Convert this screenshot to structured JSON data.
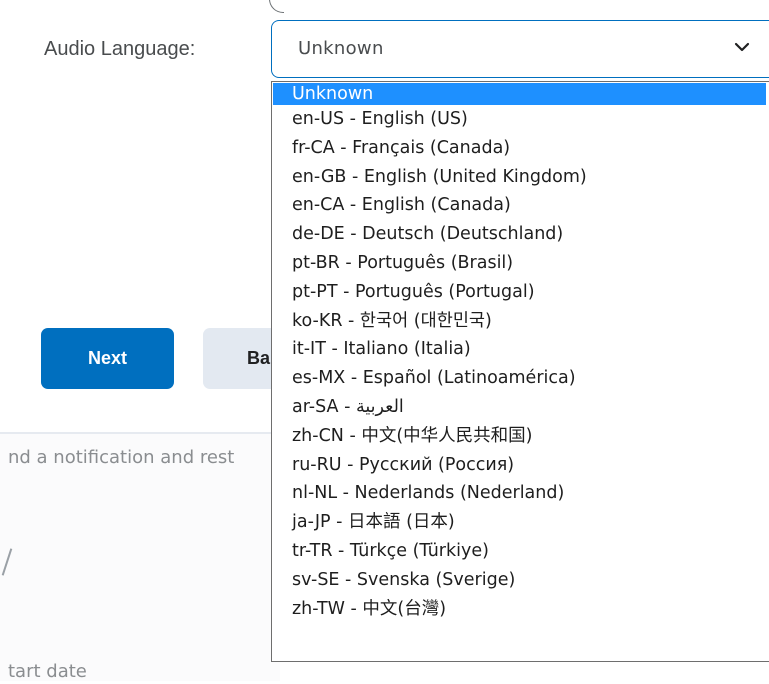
{
  "form": {
    "audio_language_label": "Audio Language:",
    "select_value": "Unknown",
    "chevron_icon": "chevron-down-icon"
  },
  "dropdown": {
    "options": [
      "Unknown",
      "en-US - English (US)",
      "fr-CA - Français (Canada)",
      "en-GB - English (United Kingdom)",
      "en-CA - English (Canada)",
      "de-DE - Deutsch (Deutschland)",
      "pt-BR - Português (Brasil)",
      "pt-PT - Português (Portugal)",
      "ko-KR - 한국어 (대한민국)",
      "it-IT - Italiano (Italia)",
      "es-MX - Español (Latinoamérica)",
      "ar-SA - العربية",
      "zh-CN - 中文(中华人民共和国)",
      "ru-RU - Русский (Россия)",
      "nl-NL - Nederlands (Nederland)",
      "ja-JP - 日本語 (日本)",
      "tr-TR - Türkçe (Türkiye)",
      "sv-SE - Svenska (Sverige)",
      "zh-TW - 中文(台灣)"
    ],
    "selected_index": 0,
    "highlight_color": "#1e90ff"
  },
  "actions": {
    "next_label": "Next",
    "back_label": "Ba",
    "primary_color": "#006fbf"
  },
  "background": {
    "notification_text": "nd a notification and rest",
    "start_date_text": "tart date"
  }
}
